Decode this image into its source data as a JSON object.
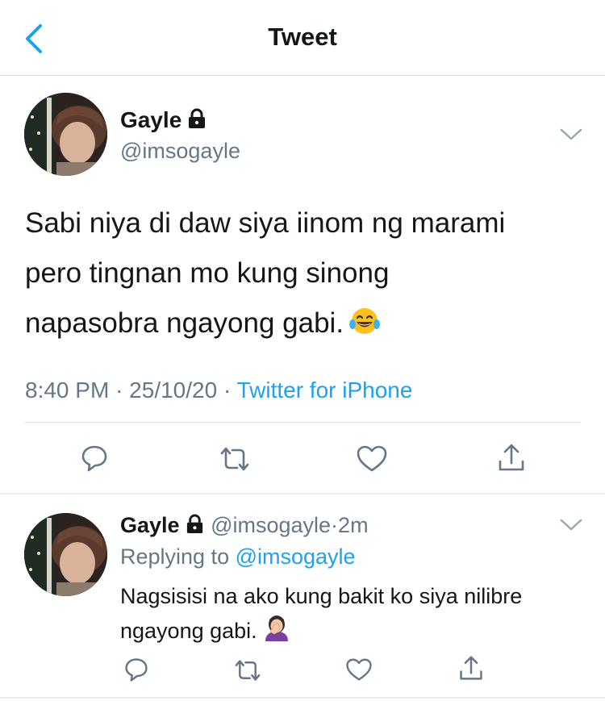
{
  "header": {
    "title": "Tweet",
    "back_icon": "chevron-left-icon"
  },
  "main_tweet": {
    "author_name": "Gayle",
    "author_handle": "@imsogayle",
    "protected": true,
    "text_line_1": "Sabi niya di daw siya iinom ng marami",
    "text_line_2": "pero tingnan mo kung sinong",
    "text_line_3": "napasobra ngayong gabi.",
    "emoji": "face-with-tears-of-joy",
    "time": "8:40 PM",
    "date": "25/10/20",
    "separator": "·",
    "source": "Twitter for iPhone",
    "actions": [
      "reply-icon",
      "retweet-icon",
      "like-icon",
      "share-icon"
    ]
  },
  "reply_tweet": {
    "author_name": "Gayle",
    "author_handle": "@imsogayle",
    "dot": "·",
    "age": "2m",
    "replying_label": "Replying to",
    "replying_to": "@imsogayle",
    "text_line_1": "Nagsisisi na ako kung bakit ko siya nilibre",
    "text_line_2": "ngayong gabi.",
    "emoji": "person-facepalming",
    "actions": [
      "reply-icon",
      "retweet-icon",
      "like-icon",
      "share-icon"
    ]
  },
  "colors": {
    "accent": "#1da1f2",
    "secondary_text": "#657786",
    "primary_text": "#14171a",
    "divider": "#d6dbe0"
  }
}
